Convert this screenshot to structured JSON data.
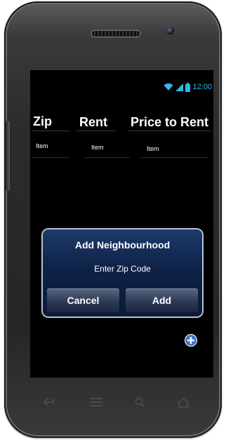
{
  "status_bar": {
    "time": "12:00",
    "icons": [
      "wifi-icon",
      "signal-icon",
      "battery-icon"
    ],
    "accent_color": "#33b5e5"
  },
  "table": {
    "headers": [
      "Zip",
      "Rent",
      "Price to Rent"
    ],
    "rows": [
      [
        "Item",
        "Item",
        "Item"
      ]
    ]
  },
  "dialog": {
    "title": "Add Neighbourhood",
    "message": "Enter Zip Code",
    "cancel_label": "Cancel",
    "add_label": "Add"
  },
  "fab": {
    "icon": "plus-circle-icon",
    "color": "#3a78c9"
  },
  "nav_bar": {
    "icons": [
      "back-icon",
      "menu-icon",
      "search-icon",
      "home-icon"
    ]
  }
}
